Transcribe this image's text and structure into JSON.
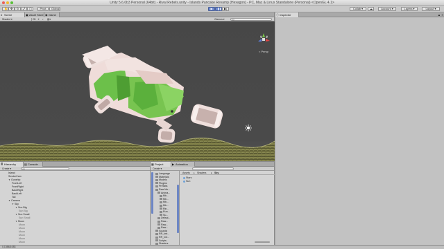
{
  "window": {
    "title": "Unity 5.6.0b3 Personal (64bit) - Rival Rebels.unity - Islands Pancake Revamp (Hexagon) - PC, Mac & Linux Standalone (Personal) <OpenGL 4.1>"
  },
  "toolbar": {
    "pivot": "Pivot",
    "global": "Global",
    "collab": "Collab",
    "account": "Account",
    "layers": "Layers",
    "layout": "Layout"
  },
  "scene_panel": {
    "tabs": [
      {
        "label": "Scene",
        "icon": "scene-icon"
      },
      {
        "label": "Asset Store",
        "icon": "store-icon"
      },
      {
        "label": "Game",
        "icon": "game-icon"
      }
    ],
    "shading_mode": "Shaded",
    "mode_2d": "2D",
    "gizmos": "Gizmos",
    "search_placeholder": "All",
    "perspective_label": "< Persp"
  },
  "inspector": {
    "tab_label": "Inspector"
  },
  "hierarchy": {
    "tabs": [
      {
        "label": "Hierarchy"
      },
      {
        "label": "Console"
      }
    ],
    "create": "Create",
    "search_placeholder": "All",
    "items": [
      {
        "label": "Island",
        "indent": 0,
        "arrow": "",
        "dim": false
      },
      {
        "label": "SmokeCam",
        "indent": 0,
        "arrow": "",
        "dim": false
      },
      {
        "label": "Gunship",
        "indent": 0,
        "arrow": "▼",
        "dim": false
      },
      {
        "label": "FrontLeft",
        "indent": 1,
        "arrow": "",
        "dim": false
      },
      {
        "label": "FrontRight",
        "indent": 1,
        "arrow": "",
        "dim": false
      },
      {
        "label": "BackRight",
        "indent": 1,
        "arrow": "",
        "dim": false
      },
      {
        "label": "BackLeft",
        "indent": 1,
        "arrow": "",
        "dim": false
      },
      {
        "label": "Tail",
        "indent": 1,
        "arrow": "",
        "dim": false
      },
      {
        "label": "Camera",
        "indent": 0,
        "arrow": "▼",
        "dim": false
      },
      {
        "label": "Sky",
        "indent": 1,
        "arrow": "▼",
        "dim": false
      },
      {
        "label": "Sun Big",
        "indent": 2,
        "arrow": "▼",
        "dim": false
      },
      {
        "label": "Sun Big",
        "indent": 3,
        "arrow": "",
        "dim": true
      },
      {
        "label": "Sun Small",
        "indent": 2,
        "arrow": "▼",
        "dim": false
      },
      {
        "label": "Sun Small",
        "indent": 3,
        "arrow": "",
        "dim": true
      },
      {
        "label": "Moon",
        "indent": 2,
        "arrow": "▼",
        "dim": false
      },
      {
        "label": "Moon",
        "indent": 3,
        "arrow": "",
        "dim": true
      },
      {
        "label": "Moon",
        "indent": 3,
        "arrow": "",
        "dim": true
      },
      {
        "label": "Moon",
        "indent": 3,
        "arrow": "",
        "dim": true
      },
      {
        "label": "Moon",
        "indent": 3,
        "arrow": "",
        "dim": true
      },
      {
        "label": "Moon",
        "indent": 3,
        "arrow": "",
        "dim": true
      },
      {
        "label": "Moon",
        "indent": 3,
        "arrow": "",
        "dim": true
      }
    ]
  },
  "project": {
    "tabs": [
      {
        "label": "Project"
      },
      {
        "label": "Animation"
      }
    ],
    "create": "Create",
    "breadcrumb": [
      "Assets",
      "Shaders",
      "Sky"
    ],
    "tree": [
      {
        "label": "Language",
        "indent": 1
      },
      {
        "label": "Materials",
        "indent": 1
      },
      {
        "label": "Models",
        "indent": 1
      },
      {
        "label": "Plugins",
        "indent": 1
      },
      {
        "label": "Prefabs",
        "indent": 1
      },
      {
        "label": "Raw Mo...",
        "indent": 1
      },
      {
        "label": "Anima...",
        "indent": 2
      },
      {
        "label": "Mb...",
        "indent": 3
      },
      {
        "label": "Mb...",
        "indent": 3
      },
      {
        "label": "Mb...",
        "indent": 3
      },
      {
        "label": "Mb...",
        "indent": 3
      },
      {
        "label": "Rin...",
        "indent": 3
      },
      {
        "label": "Run...",
        "indent": 3
      },
      {
        "label": "Su...",
        "indent": 3
      },
      {
        "label": "Defaul...",
        "indent": 2
      },
      {
        "label": "Raw...",
        "indent": 2
      },
      {
        "label": "Raw...",
        "indent": 2
      },
      {
        "label": "Raw...",
        "indent": 2
      },
      {
        "label": "Sounds",
        "indent": 1
      },
      {
        "label": "RR_Intr...",
        "indent": 1
      },
      {
        "label": "RR_Intr...",
        "indent": 1
      },
      {
        "label": "Scripts",
        "indent": 1
      },
      {
        "label": "Shaders",
        "indent": 1
      }
    ],
    "files": [
      {
        "label": "Stars"
      },
      {
        "label": "Sun"
      }
    ]
  },
  "statusbar": {
    "text": "0.1386/1083"
  }
}
